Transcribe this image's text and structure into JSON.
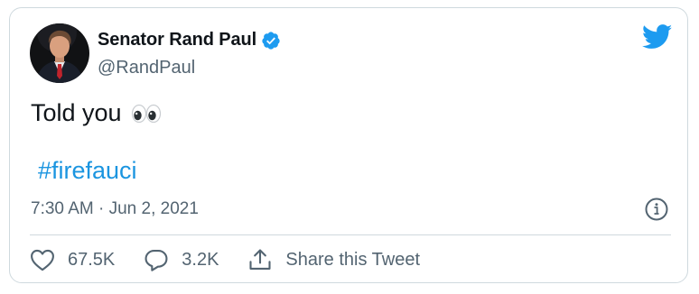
{
  "author": {
    "display_name": "Senator Rand Paul",
    "handle": "@RandPaul"
  },
  "icons": {
    "verified": "verified-badge-icon",
    "brand": "twitter-bird-icon",
    "info": "info-icon",
    "like": "heart-icon",
    "reply": "speech-bubble-icon",
    "share": "share-upload-icon",
    "emoji": "eyes-emoji-icon"
  },
  "tweet": {
    "text": "Told you",
    "hashtag": "#firefauci",
    "timestamp": "7:30 AM · Jun 2, 2021"
  },
  "actions": {
    "likes": "67.5K",
    "replies": "3.2K",
    "share_label": "Share this Tweet"
  },
  "colors": {
    "accent": "#1b95e0",
    "twitter_blue": "#1d9bf0",
    "text": "#0f1419",
    "muted": "#536471",
    "border": "#cfd9de"
  }
}
